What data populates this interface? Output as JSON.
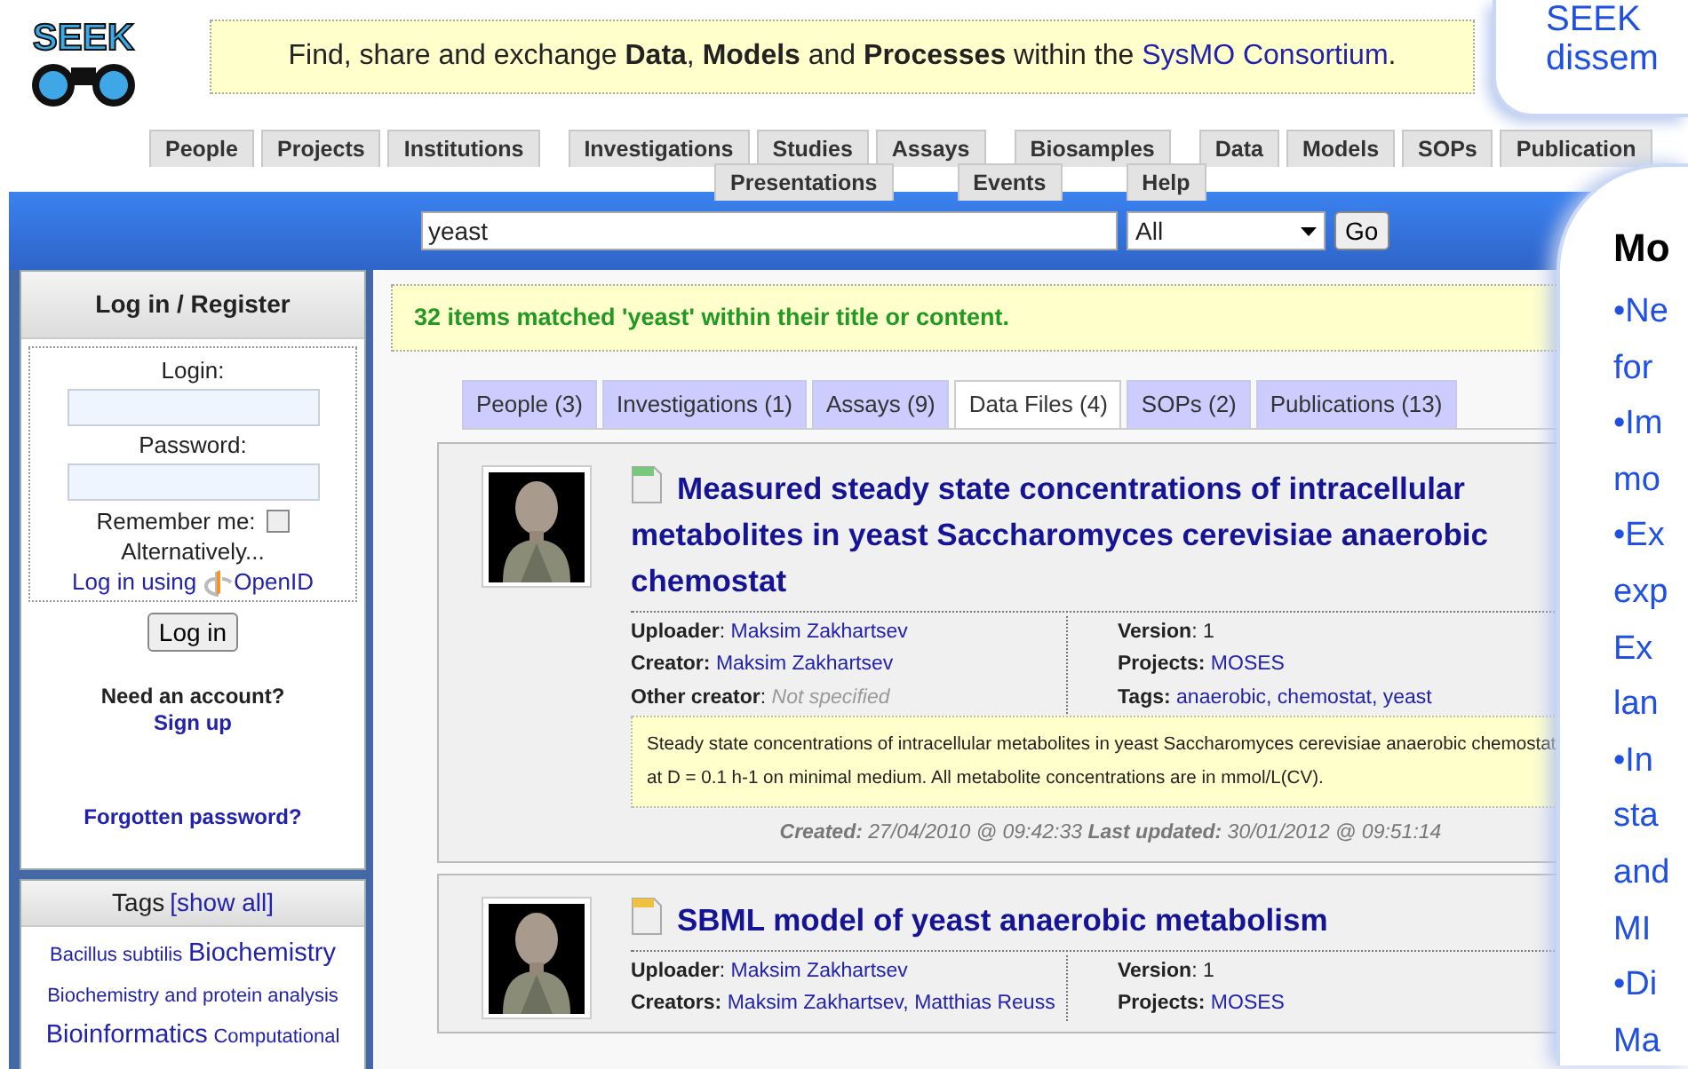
{
  "logo": {
    "text": "SEEK"
  },
  "banner": {
    "text": "Find, share and exchange **Data**, **Models** and **Processes** within the ",
    "link": "SysMO Consortium",
    "tail": "."
  },
  "callout": {
    "lines": [
      "SEEK",
      "dissem"
    ]
  },
  "nav": {
    "first_line": [
      {
        "tabs": [
          "People",
          "Projects",
          "Institutions"
        ]
      },
      {
        "tabs": [
          "Investigations",
          "Studies",
          "Assays"
        ]
      },
      {
        "tabs": [
          "Biosamples"
        ]
      },
      {
        "tabs": [
          "Data",
          "Models",
          "SOPs",
          "Publication"
        ]
      }
    ],
    "second_line": [
      {
        "tabs": [
          "Presentations"
        ]
      },
      {
        "tabs": [
          "Events"
        ]
      },
      {
        "tabs": [
          "Help"
        ]
      }
    ]
  },
  "search": {
    "value": "yeast",
    "scope": "All",
    "button": "Go"
  },
  "login": {
    "title": "Log in / Register",
    "login_label": "Login:",
    "password_label": "Password:",
    "remember_label": "Remember me:",
    "remember_checked": false,
    "alternatively": "Alternatively...",
    "openid_prefix": "Log in using",
    "openid": "OpenID",
    "button": "Log in",
    "need_account": "Need an account?",
    "signup": "Sign up",
    "forgotten": "Forgotten password?"
  },
  "tags": {
    "title": "Tags",
    "show_all": "[show all]",
    "items": [
      {
        "text": "Bacillus subtilis",
        "popular": false
      },
      {
        "text": "Biochemistry",
        "popular": true
      },
      {
        "text": "Biochemistry and protein analysis",
        "popular": false
      },
      {
        "text": "Bioinformatics",
        "popular": true
      },
      {
        "text": "Computational",
        "popular": false
      }
    ]
  },
  "results": {
    "summary": "32 items matched 'yeast' within their title or content.",
    "tabs": [
      {
        "label": "People (3)",
        "selected": false
      },
      {
        "label": "Investigations (1)",
        "selected": false
      },
      {
        "label": "Assays (9)",
        "selected": false
      },
      {
        "label": "Data Files (4)",
        "selected": true
      },
      {
        "label": "SOPs (2)",
        "selected": false
      },
      {
        "label": "Publications (13)",
        "selected": false
      }
    ],
    "items": [
      {
        "kind": "data",
        "title": "Measured steady state concentrations of intracellular metabolites in yeast Saccharomyces cerevisiae anaerobic chemostat",
        "left": [
          {
            "label": "Uploader",
            "sep": ":",
            "value": "Maksim Zakhartsev",
            "kind": "link"
          },
          {
            "label": "Creator:",
            "value": "Maksim Zakhartsev",
            "kind": "link"
          },
          {
            "label": "Other creator",
            "sep": ":",
            "value": "Not specified",
            "kind": "muted"
          }
        ],
        "right": [
          {
            "label": "Version",
            "sep": ":",
            "value": "1",
            "kind": "plain"
          },
          {
            "label": "Projects:",
            "value": "MOSES",
            "kind": "link"
          },
          {
            "label": "Tags:",
            "value": "anaerobic, chemostat, yeast",
            "kind": "link"
          }
        ],
        "description": "Steady state concentrations of intracellular metabolites in yeast Saccharomyces cerevisiae anaerobic chemostat at D = 0.1 h-1 on minimal medium. All metabolite concentrations are in mmol/L(CV).",
        "dates": "**Created:** 27/04/2010 @ 09:42:33 **Last updated:** 30/01/2012 @ 09:51:14"
      },
      {
        "kind": "model",
        "title": "SBML model of yeast anaerobic metabolism",
        "left": [
          {
            "label": "Uploader",
            "sep": ":",
            "value": "Maksim Zakhartsev",
            "kind": "link"
          },
          {
            "label": "Creators:",
            "value": "Maksim Zakhartsev, Matthias Reuss",
            "kind": "link"
          }
        ],
        "right": [
          {
            "label": "Version",
            "sep": ":",
            "value": "1",
            "kind": "plain"
          },
          {
            "label": "Projects:",
            "value": "MOSES",
            "kind": "link"
          }
        ]
      }
    ]
  },
  "slide": {
    "heading": "Mo",
    "lines": [
      "•Ne",
      "for",
      "•Im",
      "mo",
      "•Ex",
      "exp",
      "Ex",
      "lan",
      "•In",
      "sta",
      "and",
      "MI",
      "•Di",
      "Ma"
    ]
  }
}
